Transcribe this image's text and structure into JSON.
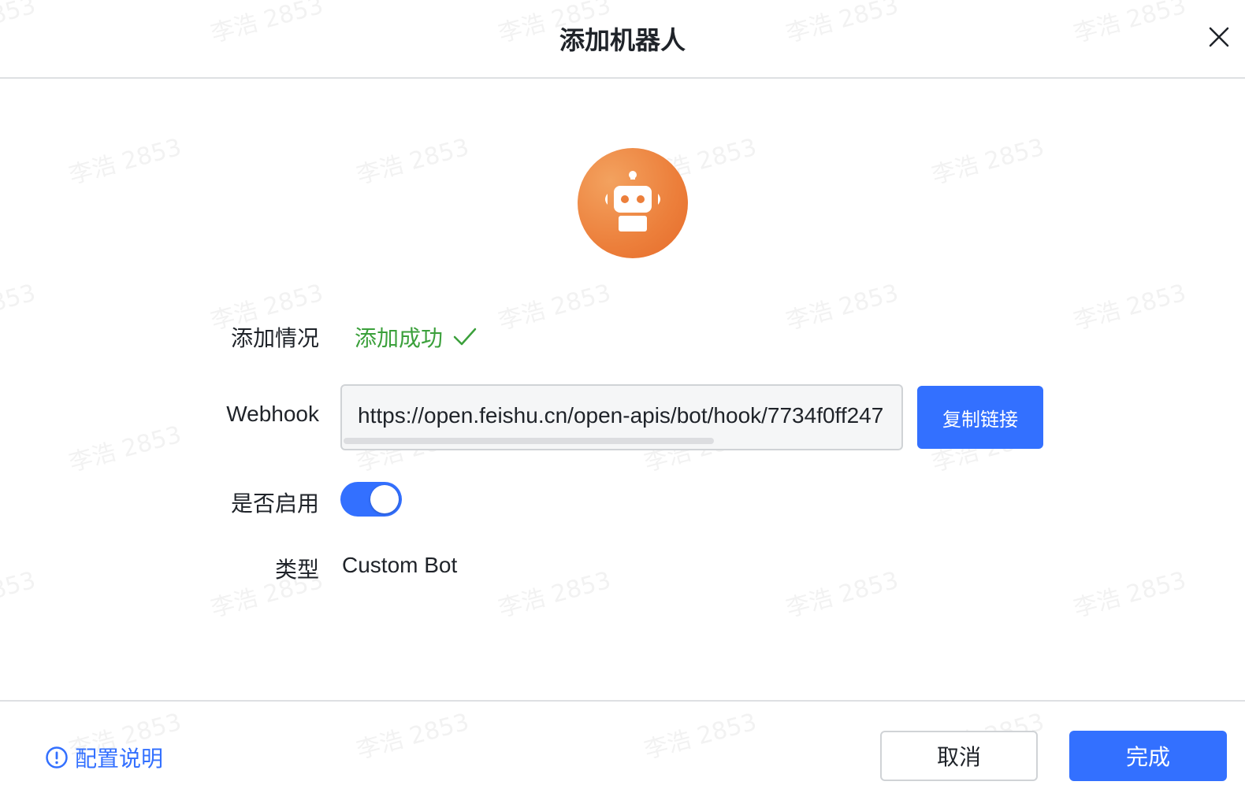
{
  "dialog": {
    "title": "添加机器人"
  },
  "watermark": {
    "text": "李浩 2853"
  },
  "form": {
    "status": {
      "label": "添加情况",
      "value": "添加成功",
      "color": "#3ba03b"
    },
    "webhook": {
      "label": "Webhook",
      "value": "https://open.feishu.cn/open-apis/bot/hook/7734f0ff247",
      "copy_button": "复制链接"
    },
    "enabled": {
      "label": "是否启用",
      "on": true
    },
    "type": {
      "label": "类型",
      "value": "Custom Bot"
    }
  },
  "footer": {
    "help_link": "配置说明",
    "cancel_button": "取消",
    "done_button": "完成"
  },
  "icons": {
    "avatar": "robot-icon",
    "close": "close-icon",
    "status": "checkmark-icon",
    "help": "info-circle-icon"
  },
  "colors": {
    "accent": "#3370ff",
    "avatar_orange": "#ec7f3b",
    "success": "#3ba03b"
  }
}
